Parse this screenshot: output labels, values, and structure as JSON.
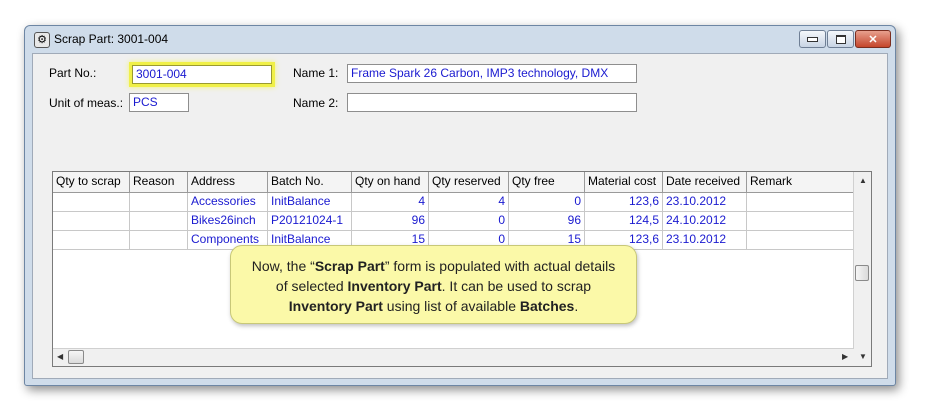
{
  "window": {
    "title": "Scrap Part: 3001-004",
    "icon": "gear-icon"
  },
  "form": {
    "part_no_label": "Part No.:",
    "part_no_value": "3001-004",
    "unit_label": "Unit of meas.:",
    "unit_value": "PCS",
    "name1_label": "Name 1:",
    "name1_value": "Frame Spark 26 Carbon, IMP3 technology, DMX",
    "name2_label": "Name 2:",
    "name2_value": ""
  },
  "grid": {
    "columns": [
      "Qty to scrap",
      "Reason",
      "Address",
      "Batch No.",
      "Qty on hand",
      "Qty reserved",
      "Qty free",
      "Material cost",
      "Date received",
      "Remark"
    ],
    "rows": [
      [
        "",
        "",
        "Accessories",
        "InitBalance",
        "4",
        "4",
        "0",
        "123,6",
        "23.10.2012",
        ""
      ],
      [
        "",
        "",
        "Bikes26inch",
        "P20121024-1",
        "96",
        "0",
        "96",
        "124,5",
        "24.10.2012",
        ""
      ],
      [
        "",
        "",
        "Components",
        "InitBalance",
        "15",
        "0",
        "15",
        "123,6",
        "23.10.2012",
        ""
      ]
    ]
  },
  "callout": {
    "t1": "Now, the “",
    "b1": "Scrap Part",
    "t2": "” form is populated with actual details of selected ",
    "b2": "Inventory Part",
    "t3": ".  It can be used to scrap ",
    "b3": "Inventory Part",
    "t4": " using list of available ",
    "b4": "Batches",
    "t5": "."
  },
  "colors": {
    "value_text": "#1a1ad0",
    "highlight": "#f0f048",
    "callout_bg": "#fbf9a8"
  }
}
